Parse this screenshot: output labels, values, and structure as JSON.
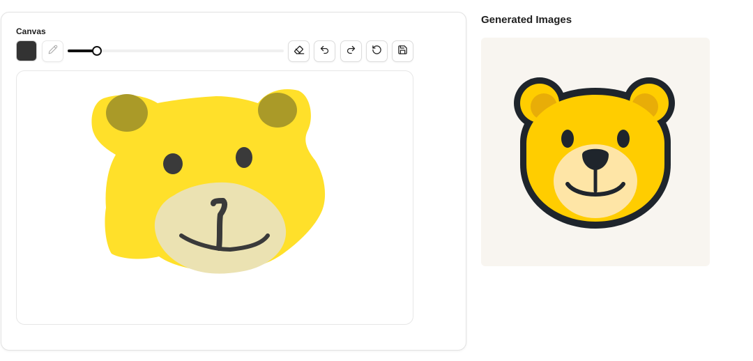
{
  "canvas": {
    "title": "Canvas",
    "brush_color": "#333333",
    "brush_size_fraction": 0.137,
    "background_color": "#ffffff"
  },
  "toolbar": {
    "tools": [
      "pencil-icon",
      "eraser-icon",
      "undo-icon",
      "redo-icon",
      "reset-icon",
      "save-icon"
    ]
  },
  "gallery": {
    "title": "Generated Images",
    "image_background": "#f8f5f0",
    "image_subject": "teddy-bear-face"
  },
  "colors": {
    "sketch_yellow": "#ffe02a",
    "sketch_ear": "#aa9a28",
    "sketch_muzzle": "#ebe2b2",
    "sketch_ink": "#3a3a3a",
    "gen_yellow": "#ffcd00",
    "gen_ear_inner": "#e8ad08",
    "gen_muzzle": "#fee5a6",
    "gen_outline": "#1f252c"
  }
}
